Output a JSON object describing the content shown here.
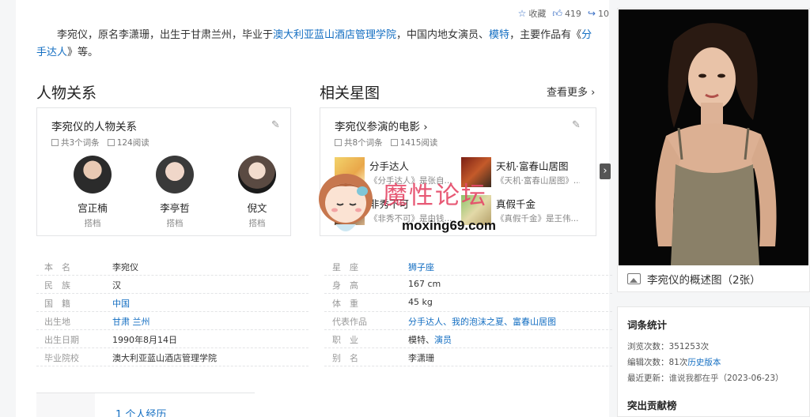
{
  "actions": {
    "favorite_label": "收藏",
    "like_count": "419",
    "share_count": "10"
  },
  "summary": {
    "p1": "李宛仪，原名李潇珊，出生于甘肃兰州，毕业于",
    "school_link": "澳大利亚蓝山酒店管理学院",
    "p2": "，中国内地女演员、",
    "model_link": "模特",
    "p3": "，主要作品有《",
    "work_link": "分手达人",
    "p4": "》等。"
  },
  "relations": {
    "section_title": "人物关系",
    "card_title": "李宛仪的人物关系",
    "entries": "共3个词条",
    "reads": "124阅读",
    "people": [
      {
        "name": "宫正楠",
        "role": "搭档"
      },
      {
        "name": "李亭哲",
        "role": "搭档"
      },
      {
        "name": "倪文",
        "role": "搭档"
      }
    ]
  },
  "stars": {
    "section_title": "相关星图",
    "see_more": "查看更多",
    "card_title": "李宛仪参演的电影",
    "entries": "共8个词条",
    "reads": "1415阅读",
    "films": [
      {
        "title": "分手达人",
        "desc": "《分手达人》是张自..."
      },
      {
        "title": "天机·富春山居图",
        "desc": "《天机·富春山居图》..."
      },
      {
        "title": "非秀不可",
        "desc": "《非秀不可》是由钱..."
      },
      {
        "title": "真假千金",
        "desc": "《真假千金》是王伟..."
      }
    ]
  },
  "info": {
    "left": [
      {
        "k": "本　名",
        "v": "李宛仪"
      },
      {
        "k": "民　族",
        "v": "汉"
      },
      {
        "k": "国　籍",
        "v": "中国"
      },
      {
        "k": "出生地",
        "v": "甘肃 兰州"
      },
      {
        "k": "出生日期",
        "v": "1990年8月14日"
      },
      {
        "k": "毕业院校",
        "v": "澳大利亚蓝山酒店管理学院"
      }
    ],
    "right": [
      {
        "k": "星　座",
        "v": "狮子座"
      },
      {
        "k": "身　高",
        "v": "167 cm"
      },
      {
        "k": "体　重",
        "v": "45 kg"
      },
      {
        "k": "代表作品",
        "v": "分手达人、我的泡沫之夏、富春山居图"
      },
      {
        "k": "职　业",
        "v": "模特、",
        "v2": "演员"
      },
      {
        "k": "别　名",
        "v": "李潇珊"
      }
    ]
  },
  "toc": {
    "first_item": "1  个人经历"
  },
  "sidebar": {
    "photo_caption": "李宛仪的概述图（2张）",
    "stats_title": "词条统计",
    "views": "浏览次数：351253次",
    "edits_prefix": "编辑次数：81次",
    "edits_link": "历史版本",
    "updated_prefix": "最近更新：",
    "updated_user": "谁说我都在乎",
    "updated_date": "（2023-06-23）",
    "contrib_title": "突出贡献榜"
  },
  "watermark": {
    "text": "魔性论坛",
    "url": "moxing69.com"
  }
}
